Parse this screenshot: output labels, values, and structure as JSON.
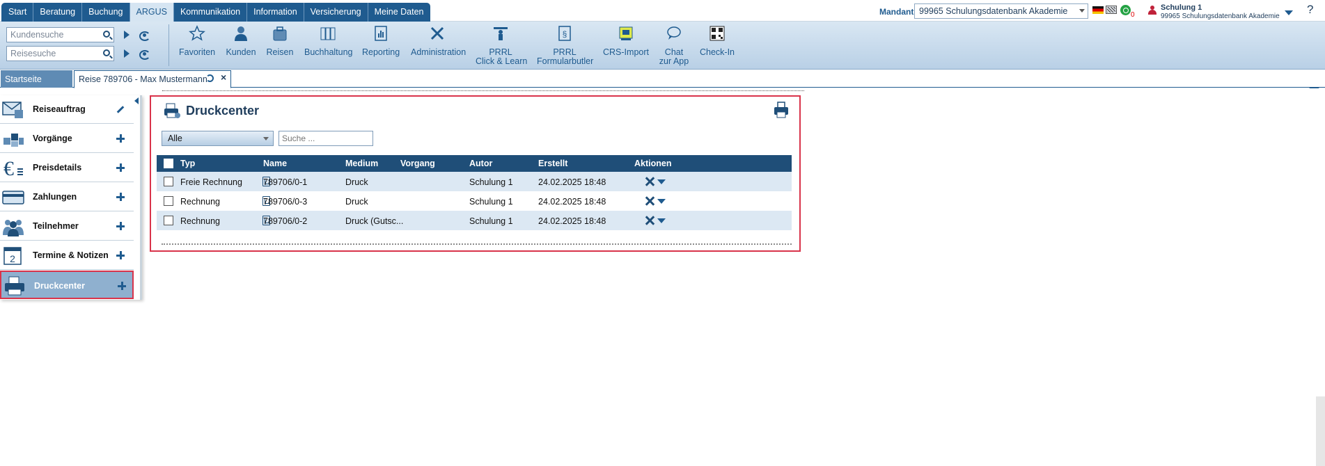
{
  "mainmenu": {
    "items": [
      "Start",
      "Beratung",
      "Buchung",
      "ARGUS",
      "Kommunikation",
      "Information",
      "Versicherung",
      "Meine Daten"
    ],
    "active": "ARGUS"
  },
  "header": {
    "mandant_label": "Mandant",
    "mandant_value": "99965 Schulungsdatenbank Akademie",
    "whatsapp_count": "0",
    "user_name": "Schulung 1",
    "user_db": "99965 Schulungsdatenbank Akademie",
    "help": "?"
  },
  "search": {
    "kunden_placeholder": "Kundensuche",
    "reise_placeholder": "Reisesuche"
  },
  "ribbon": {
    "favoriten": "Favoriten",
    "kunden": "Kunden",
    "reisen": "Reisen",
    "buchhaltung": "Buchhaltung",
    "reporting": "Reporting",
    "administration": "Administration",
    "prrl_click_1": "PRRL",
    "prrl_click_2": "Click & Learn",
    "prrl_form_1": "PRRL",
    "prrl_form_2": "Formularbutler",
    "crs_import": "CRS-Import",
    "chat_1": "Chat",
    "chat_2": "zur App",
    "checkin": "Check-In"
  },
  "tabs": {
    "start": "Startseite",
    "reise": "Reise 789706 - Max Mustermann"
  },
  "sidebar": {
    "items": [
      {
        "label": "Reiseauftrag"
      },
      {
        "label": "Vorgänge"
      },
      {
        "label": "Preisdetails"
      },
      {
        "label": "Zahlungen"
      },
      {
        "label": "Teilnehmer"
      },
      {
        "label": "Termine & Notizen"
      },
      {
        "label": "Druckcenter"
      }
    ],
    "active": "Druckcenter"
  },
  "druckcenter": {
    "title": "Druckcenter",
    "filter_value": "Alle",
    "search_placeholder": "Suche ...",
    "columns": {
      "typ": "Typ",
      "name": "Name",
      "medium": "Medium",
      "vorgang": "Vorgang",
      "autor": "Autor",
      "erstellt": "Erstellt",
      "aktionen": "Aktionen"
    },
    "rows": [
      {
        "typ": "Freie Rechnung",
        "name": "789706/0-1",
        "medium": "Druck",
        "vorgang": "",
        "autor": "Schulung 1",
        "erstellt": "24.02.2025 18:48"
      },
      {
        "typ": "Rechnung",
        "name": "789706/0-3",
        "medium": "Druck",
        "vorgang": "",
        "autor": "Schulung 1",
        "erstellt": "24.02.2025 18:48"
      },
      {
        "typ": "Rechnung",
        "name": "789706/0-2",
        "medium": "Druck (Gutsc...",
        "vorgang": "",
        "autor": "Schulung 1",
        "erstellt": "24.02.2025 18:48"
      }
    ]
  },
  "colors": {
    "nav_blue": "#1f5b8f",
    "table_header": "#1f4e78",
    "row_alt": "#dce8f3",
    "highlight_red": "#d9334a"
  }
}
